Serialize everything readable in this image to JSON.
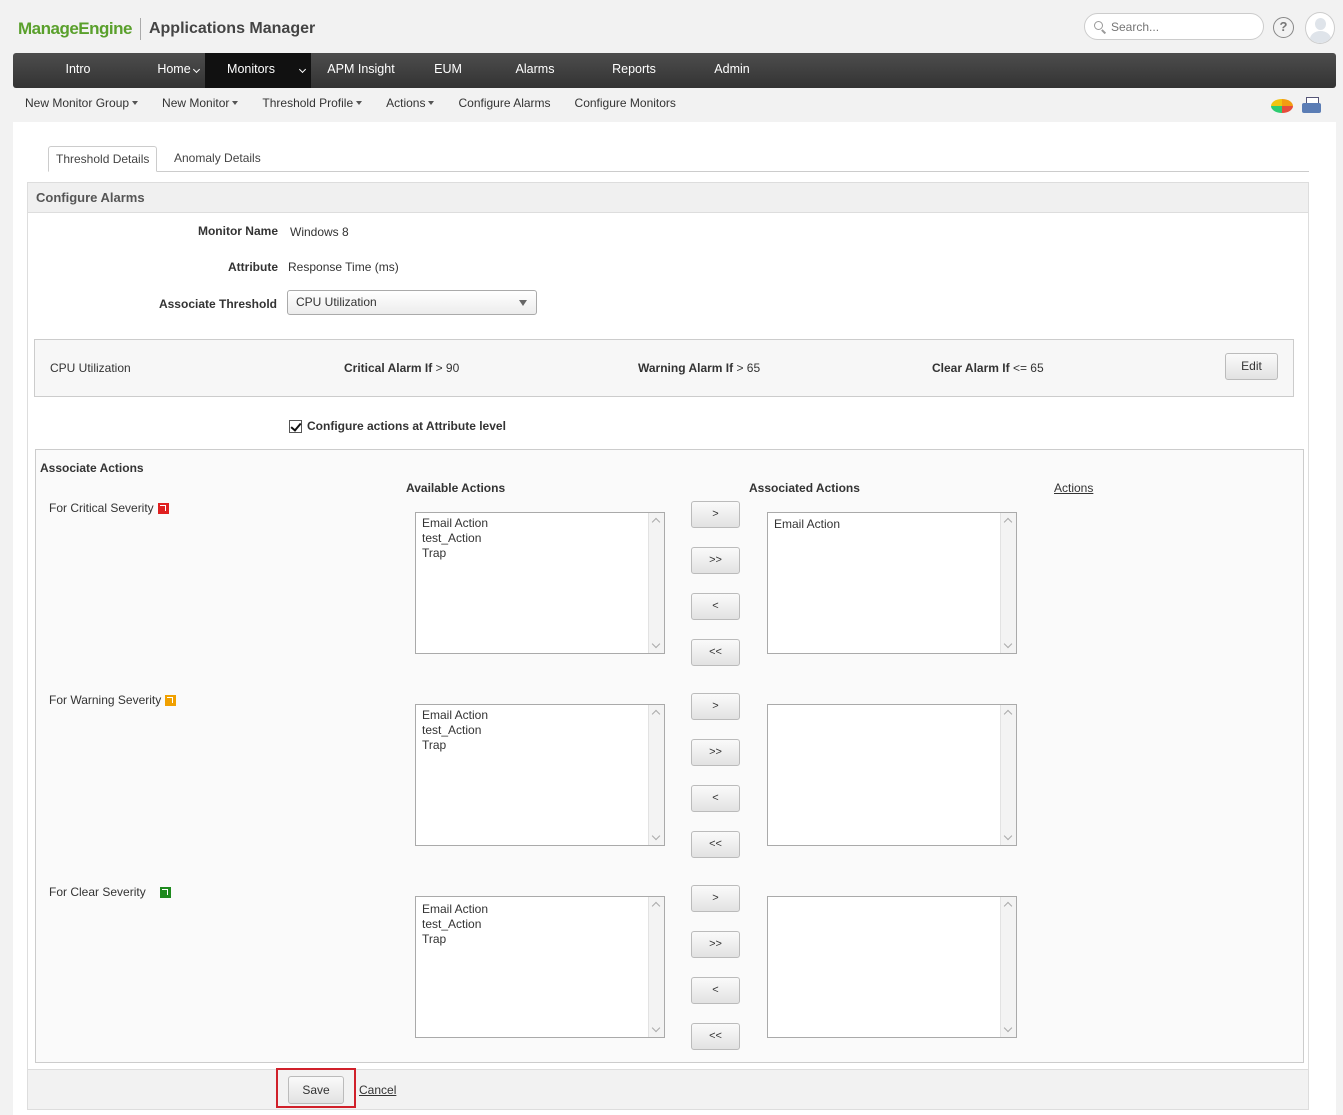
{
  "brand": {
    "logo_part1": "Manage",
    "logo_part2": "Engine",
    "app_name": "Applications Manager"
  },
  "search": {
    "placeholder": "Search..."
  },
  "help": {
    "label": "?"
  },
  "mainnav": {
    "items": [
      {
        "label": "Intro",
        "has_caret": false
      },
      {
        "label": "Home",
        "has_caret": true
      },
      {
        "label": "Monitors",
        "has_caret": true,
        "active": true
      },
      {
        "label": "APM Insight",
        "has_caret": false
      },
      {
        "label": "EUM",
        "has_caret": false
      },
      {
        "label": "Alarms",
        "has_caret": false
      },
      {
        "label": "Reports",
        "has_caret": false
      },
      {
        "label": "Admin",
        "has_caret": false
      }
    ]
  },
  "subnav": {
    "items": [
      {
        "label": "New Monitor Group",
        "has_caret": true
      },
      {
        "label": "New Monitor",
        "has_caret": true
      },
      {
        "label": "Threshold Profile",
        "has_caret": true
      },
      {
        "label": "Actions",
        "has_caret": true
      },
      {
        "label": "Configure Alarms",
        "has_caret": false
      },
      {
        "label": "Configure Monitors",
        "has_caret": false
      }
    ]
  },
  "tabs": {
    "threshold": "Threshold Details",
    "anomaly": "Anomaly Details"
  },
  "section": {
    "title": "Configure Alarms"
  },
  "form": {
    "monitor_name_label": "Monitor Name",
    "monitor_name_value": "Windows 8",
    "attribute_label": "Attribute",
    "attribute_value": "Response Time (ms)",
    "threshold_label": "Associate Threshold",
    "threshold_selected": "CPU Utilization"
  },
  "threshold": {
    "name": "CPU Utilization",
    "critical_label": "Critical Alarm If",
    "critical_value": "> 90",
    "warning_label": "Warning Alarm If",
    "warning_value": "> 65",
    "clear_label": "Clear Alarm If",
    "clear_value": "<= 65",
    "edit_label": "Edit"
  },
  "configure_actions": {
    "label": "Configure actions at Attribute level",
    "checked": true
  },
  "associate": {
    "title": "Associate Actions",
    "available_header": "Available Actions",
    "associated_header": "Associated Actions",
    "actions_link": "Actions",
    "move_buttons": [
      ">",
      ">>",
      "<",
      "<<"
    ],
    "severities": [
      {
        "label": "For Critical Severity",
        "available": [
          "Email Action",
          "test_Action",
          "Trap"
        ],
        "associated": [
          "Email Action"
        ]
      },
      {
        "label": "For Warning Severity",
        "available": [
          "Email Action",
          "test_Action",
          "Trap"
        ],
        "associated": []
      },
      {
        "label": "For Clear Severity",
        "available": [
          "Email Action",
          "test_Action",
          "Trap"
        ],
        "associated": []
      }
    ]
  },
  "footer": {
    "save_label": "Save",
    "cancel_label": "Cancel"
  }
}
